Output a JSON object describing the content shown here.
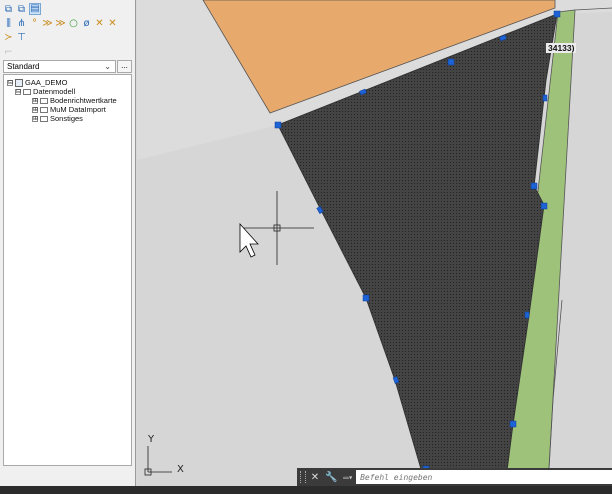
{
  "toolbar": {
    "row1": [
      {
        "icon": "layers-icon",
        "glyph": "⧉"
      },
      {
        "icon": "layers-swap-icon",
        "glyph": "⧉"
      },
      {
        "icon": "layer-manager-icon",
        "glyph": "▤"
      }
    ],
    "row2": [
      {
        "icon": "split-icon",
        "glyph": "⫼"
      },
      {
        "icon": "fork-icon",
        "glyph": "⋔"
      },
      {
        "icon": "node-icon",
        "glyph": "°"
      },
      {
        "icon": "branch-icon",
        "glyph": "≫"
      },
      {
        "icon": "branch-outline-icon",
        "glyph": "≫"
      },
      {
        "icon": "ellipse-icon",
        "glyph": "○"
      },
      {
        "icon": "no-symbol-icon",
        "glyph": "ø"
      },
      {
        "icon": "cross-lines-icon",
        "glyph": "✕"
      },
      {
        "icon": "cross-lines-2-icon",
        "glyph": "✕"
      }
    ],
    "row3": [
      {
        "icon": "bend-icon",
        "glyph": "≻"
      },
      {
        "icon": "stamp-icon",
        "glyph": "⊤"
      }
    ],
    "row4": [
      {
        "icon": "disabled-tool-icon",
        "glyph": "⌐"
      }
    ]
  },
  "dropdown": {
    "value": "Standard",
    "more_label": "..."
  },
  "tree": [
    {
      "label": "GAA_DEMO",
      "expander": "⊟",
      "icon": "database-icon"
    },
    {
      "label": "Datenmodell",
      "expander": "⊟",
      "icon": "folder-icon"
    },
    {
      "label": "Bodenrichtwertkarte",
      "expander": "⊞",
      "icon": "folder-icon"
    },
    {
      "label": "MuM DataImport",
      "expander": "⊞",
      "icon": "folder-icon"
    },
    {
      "label": "Sonstiges",
      "expander": "⊞",
      "icon": "folder-icon"
    }
  ],
  "map": {
    "parcel_label": "34133)",
    "axis_x": "X",
    "axis_y": "Y",
    "colors": {
      "background": "#d6d6d6",
      "orange_area": "#e8a96d",
      "hatched_area": "#3f3f3f",
      "green_strip": "#9fc27a",
      "grips": "#1e63d6"
    }
  },
  "command": {
    "close_glyph": "✕",
    "wrench_glyph": "🔧",
    "prompt_glyph": "▭▾",
    "placeholder": "Befehl eingeben"
  }
}
